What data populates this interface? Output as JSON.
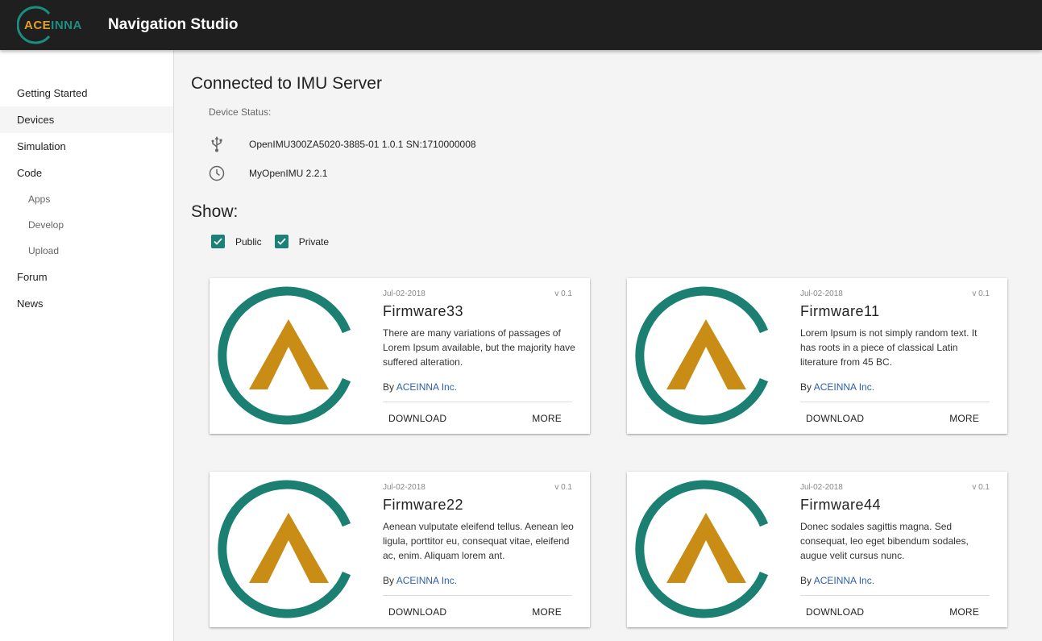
{
  "app": {
    "logo_text_a": "ACE",
    "logo_text_b": "INNA",
    "title": "Navigation Studio"
  },
  "sidebar": {
    "items": [
      {
        "label": "Getting Started"
      },
      {
        "label": "Devices"
      },
      {
        "label": "Simulation"
      },
      {
        "label": "Code"
      },
      {
        "label": "Apps"
      },
      {
        "label": "Develop"
      },
      {
        "label": "Upload"
      },
      {
        "label": "Forum"
      },
      {
        "label": "News"
      }
    ]
  },
  "main": {
    "heading": "Connected to IMU Server",
    "status_label": "Device Status:",
    "device": "OpenIMU300ZA5020-3885-01 1.0.1 SN:1710000008",
    "app_version": "MyOpenIMU 2.2.1",
    "show_heading": "Show:",
    "filters": [
      {
        "label": "Public",
        "checked": true
      },
      {
        "label": "Private",
        "checked": true
      }
    ]
  },
  "cards": [
    {
      "date": "Jul-02-2018",
      "version": "v 0.1",
      "name": "Firmware33",
      "description": "There are many variations of passages of Lorem Ipsum available, but the majority have suffered alteration.",
      "by_prefix": "By",
      "author": "ACEINNA Inc.",
      "download": "DOWNLOAD",
      "more": "MORE"
    },
    {
      "date": "Jul-02-2018",
      "version": "v 0.1",
      "name": "Firmware11",
      "description": "Lorem Ipsum is not simply random text. It has roots in a piece of classical Latin literature from 45 BC.",
      "by_prefix": "By",
      "author": "ACEINNA Inc.",
      "download": "DOWNLOAD",
      "more": "MORE"
    },
    {
      "date": "Jul-02-2018",
      "version": "v 0.1",
      "name": "Firmware22",
      "description": "Aenean vulputate eleifend tellus. Aenean leo ligula, porttitor eu, consequat vitae, eleifend ac, enim. Aliquam lorem ant.",
      "by_prefix": "By",
      "author": "ACEINNA Inc.",
      "download": "DOWNLOAD",
      "more": "MORE"
    },
    {
      "date": "Jul-02-2018",
      "version": "v 0.1",
      "name": "Firmware44",
      "description": "Donec sodales sagittis magna. Sed consequat, leo eget bibendum sodales, augue velit cursus nunc.",
      "by_prefix": "By",
      "author": "ACEINNA Inc.",
      "download": "DOWNLOAD",
      "more": "MORE"
    }
  ],
  "colors": {
    "topbar": "#1f1f1f",
    "accent_teal": "#1b7f72",
    "accent_gold": "#c98c15",
    "checkbox": "#1b8076",
    "link": "#2c5fa8"
  },
  "icons": {
    "usb": "usb-icon",
    "clock": "clock-icon",
    "check": "checkmark-icon"
  }
}
